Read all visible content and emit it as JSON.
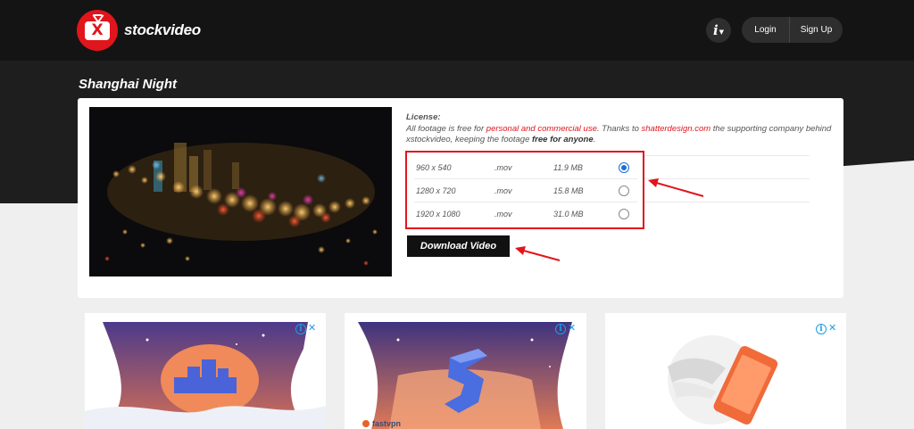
{
  "header": {
    "logo_text": "stockvideo",
    "logo_badge_letter": "X",
    "info_label": "i",
    "login_label": "Login",
    "signup_label": "Sign Up"
  },
  "page": {
    "title": "Shanghai Night"
  },
  "license": {
    "label": "License:",
    "text_1": "All footage is free for ",
    "link_use": "personal and commercial use",
    "text_2": ". Thanks to ",
    "link_sponsor": "shatterdesign.com",
    "text_3": " the supporting company behind xstockvideo, keeping the footage ",
    "emphasis": "free for anyone",
    "text_4": "."
  },
  "download_options": [
    {
      "resolution": "960 x 540",
      "format": ".mov",
      "size": "11.9 MB",
      "selected": true
    },
    {
      "resolution": "1280 x 720",
      "format": ".mov",
      "size": "15.8 MB",
      "selected": false
    },
    {
      "resolution": "1920 x 1080",
      "format": ".mov",
      "size": "31.0 MB",
      "selected": false
    }
  ],
  "download_button_label": "Download Video",
  "ads": {
    "adchoices_icon": "i",
    "close_icon": "✕",
    "ad2_brand": "fastvpn"
  },
  "colors": {
    "brand_red": "#e1151c",
    "header_bg": "#141414",
    "radio_selected": "#1c6fd6",
    "adchoices": "#1c9ee6"
  }
}
